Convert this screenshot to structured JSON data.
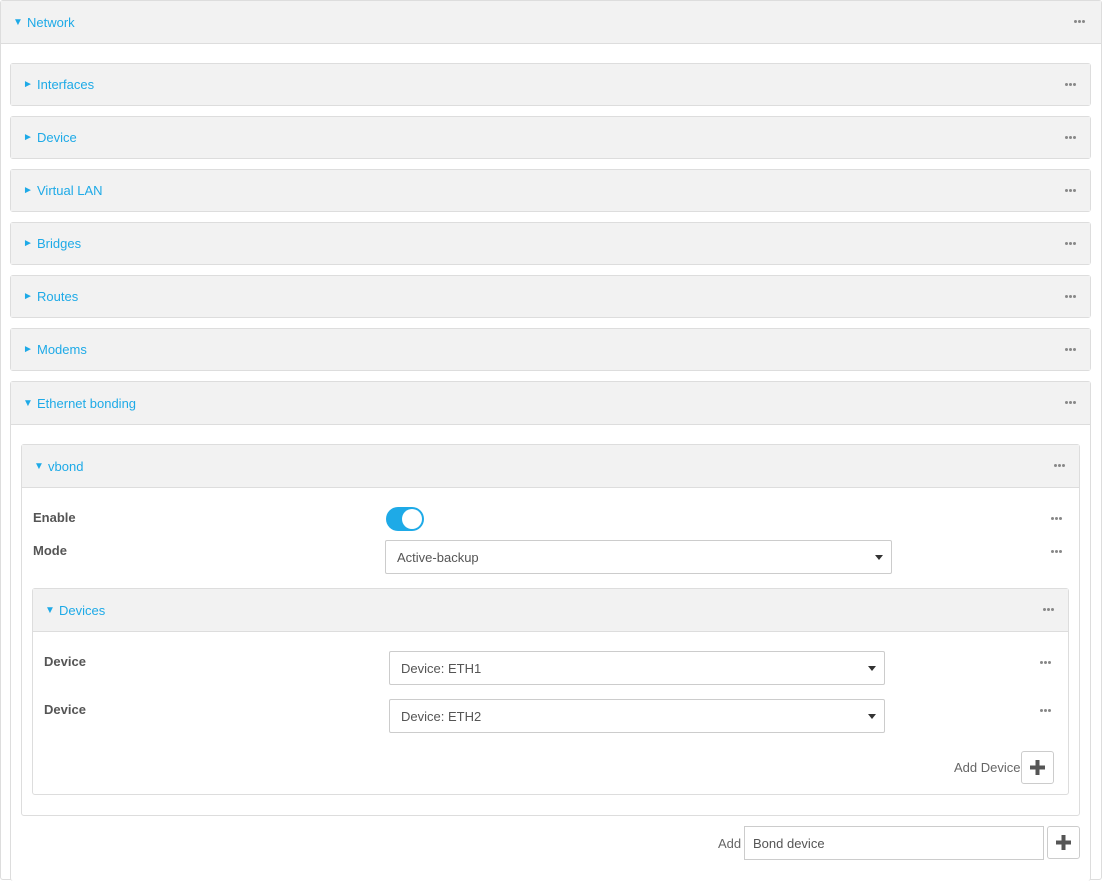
{
  "network": {
    "title": "Network"
  },
  "sections": [
    {
      "title": "Interfaces"
    },
    {
      "title": "Device"
    },
    {
      "title": "Virtual LAN"
    },
    {
      "title": "Bridges"
    },
    {
      "title": "Routes"
    },
    {
      "title": "Modems"
    }
  ],
  "bonding": {
    "title": "Ethernet bonding",
    "vbond": {
      "title": "vbond",
      "enable_label": "Enable",
      "enable_value": true,
      "mode_label": "Mode",
      "mode_value": "Active-backup",
      "devices": {
        "title": "Devices",
        "rows": [
          {
            "label": "Device",
            "value": "Device: ETH1"
          },
          {
            "label": "Device",
            "value": "Device: ETH2"
          }
        ],
        "add_label": "Add Device"
      }
    },
    "add_label": "Add",
    "add_input_value": "Bond device"
  },
  "icons": {
    "more": "more-dots-icon",
    "plus": "plus-icon",
    "expanded": "triangle-down-icon",
    "collapsed": "triangle-right-icon"
  },
  "colors": {
    "accent": "#1eaae7",
    "header_bg": "#f2f2f2",
    "border": "#dddddd"
  }
}
